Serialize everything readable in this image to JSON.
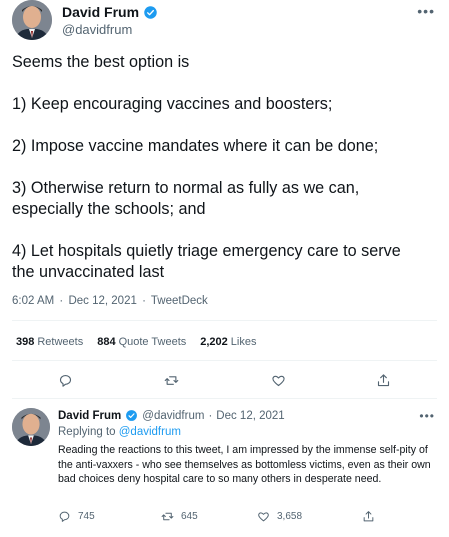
{
  "colors": {
    "accent": "#1d9bf0",
    "text": "#0f1419",
    "muted": "#536471",
    "divider": "#eff3f4"
  },
  "tweet": {
    "author_name": "David Frum",
    "author_handle": "@davidfrum",
    "lines": [
      "Seems the best option is",
      "",
      "1) Keep encouraging vaccines and boosters;",
      "",
      "2) Impose vaccine mandates where it can be done;",
      "",
      "3) Otherwise return to normal as fully as we can,",
      "especially the schools; and",
      "",
      "4) Let hospitals quietly triage emergency care to serve",
      "the unvaccinated last"
    ],
    "time": "6:02 AM",
    "date": "Dec 12, 2021",
    "source": "TweetDeck",
    "sep": "·",
    "stats": {
      "retweets_count": "398",
      "retweets_label": "Retweets",
      "quote_count": "884",
      "quote_label": "Quote Tweets",
      "likes_count": "2,202",
      "likes_label": "Likes"
    }
  },
  "reply": {
    "author_name": "David Frum",
    "author_handle": "@davidfrum",
    "sep": "·",
    "date": "Dec 12, 2021",
    "replying_prefix": "Replying to",
    "replying_to": "@davidfrum",
    "text": "Reading the reactions to this tweet, I am impressed by the immense self-pity of the anti-vaxxers - who see themselves as bottomless victims, even as their own bad choices deny hospital care to so many others in desperate need.",
    "reply_count": "745",
    "retweet_count": "645",
    "like_count": "3,658"
  },
  "icons": {
    "more": "more-icon",
    "reply": "reply-icon",
    "retweet": "retweet-icon",
    "like": "heart-icon",
    "share": "share-icon",
    "verified": "verified-badge-icon"
  }
}
